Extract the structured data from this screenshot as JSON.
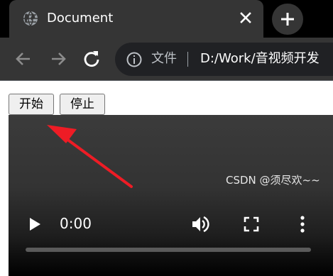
{
  "tab": {
    "title": "Document",
    "favicon": "globe-icon",
    "close_icon": "close-icon"
  },
  "new_tab": {
    "icon": "plus-icon"
  },
  "toolbar": {
    "back_icon": "arrow-left-icon",
    "forward_icon": "arrow-right-icon",
    "reload_icon": "reload-icon",
    "info_icon": "info-icon",
    "scheme_label": "文件",
    "url": "D:/Work/音视频开发"
  },
  "page": {
    "start_button": "开始",
    "stop_button": "停止"
  },
  "video": {
    "time": "0:00",
    "play_icon": "play-icon",
    "volume_icon": "volume-icon",
    "fullscreen_icon": "fullscreen-icon",
    "more_icon": "more-vertical-icon",
    "progress": 0
  },
  "annotation": {
    "arrow_color": "#ee1c25",
    "target": "start_button"
  },
  "watermark": "CSDN @须尽欢~~",
  "colors": {
    "tab_bg": "#353535",
    "tabstrip_bg": "#000000",
    "omnibox_bg": "#202124",
    "video_bg": "#000000"
  }
}
